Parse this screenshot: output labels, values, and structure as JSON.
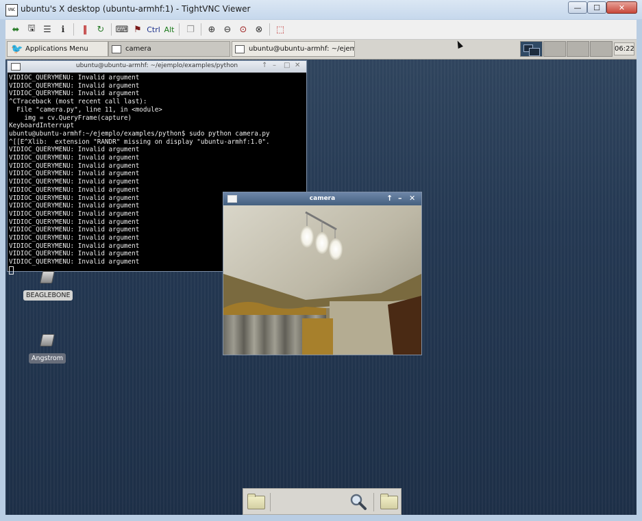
{
  "vnc": {
    "title": "ubuntu's X desktop (ubuntu-armhf:1) - TightVNC Viewer",
    "app_icon_text": "VNC",
    "toolbar": {
      "ctrl_label": "Ctrl",
      "alt_label": "Alt",
      "icons": [
        "new-connection-icon",
        "save-icon",
        "options-icon",
        "info-icon",
        "pause-icon",
        "refresh-icon",
        "ctrl-alt-del-icon",
        "ctrl-esc-icon",
        "copy-icon",
        "zoom-in-icon",
        "zoom-out-icon",
        "zoom-100-icon",
        "zoom-fit-icon",
        "fullscreen-icon"
      ]
    }
  },
  "taskbar": {
    "apps_menu_label": "Applications Menu",
    "tasks": [
      {
        "label": "camera"
      },
      {
        "label": "ubuntu@ubuntu-armhf: ~/ejemp..."
      }
    ],
    "clock": "06:22"
  },
  "terminal": {
    "title": "ubuntu@ubuntu-armhf: ~/ejemplo/examples/python",
    "lines": [
      "VIDIOC_QUERYMENU: Invalid argument",
      "VIDIOC_QUERYMENU: Invalid argument",
      "VIDIOC_QUERYMENU: Invalid argument",
      "^CTraceback (most recent call last):",
      "  File \"camera.py\", line 11, in <module>",
      "    img = cv.QueryFrame(capture)",
      "KeyboardInterrupt",
      "ubuntu@ubuntu-armhf:~/ejemplo/examples/python$ sudo python camera.py",
      "^[[E^Xlib:  extension \"RANDR\" missing on display \"ubuntu-armhf:1.0\".",
      "VIDIOC_QUERYMENU: Invalid argument",
      "VIDIOC_QUERYMENU: Invalid argument",
      "VIDIOC_QUERYMENU: Invalid argument",
      "VIDIOC_QUERYMENU: Invalid argument",
      "VIDIOC_QUERYMENU: Invalid argument",
      "VIDIOC_QUERYMENU: Invalid argument",
      "VIDIOC_QUERYMENU: Invalid argument",
      "VIDIOC_QUERYMENU: Invalid argument",
      "VIDIOC_QUERYMENU: Invalid argument",
      "VIDIOC_QUERYMENU: Invalid argument",
      "VIDIOC_QUERYMENU: Invalid argument",
      "VIDIOC_QUERYMENU: Invalid argument",
      "VIDIOC_QUERYMENU: Invalid argument",
      "VIDIOC_QUERYMENU: Invalid argument",
      "VIDIOC_QUERYMENU: Invalid argument"
    ]
  },
  "desktop_icons": [
    {
      "label": "BEAGLEBONE"
    },
    {
      "label": "Angstrom"
    }
  ],
  "camera": {
    "title": "camera"
  },
  "colors": {
    "desktop_bg": "#243852",
    "camera_titlebar": "#5a7494",
    "terminal_bg": "#000000",
    "taskbar_bg": "#d6d4ce"
  }
}
